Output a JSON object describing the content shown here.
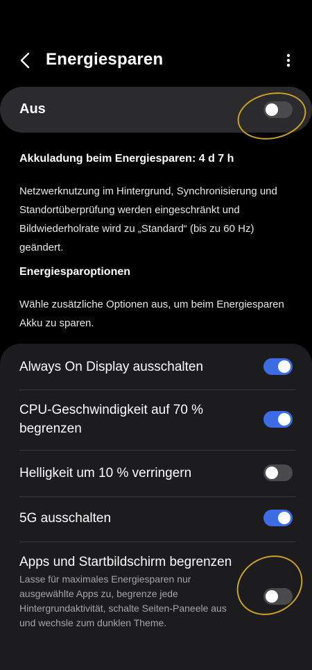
{
  "header": {
    "title": "Energiesparen"
  },
  "master": {
    "label": "Aus",
    "state": "off"
  },
  "info": {
    "heading": "Akkuladung beim Energiesparen: 4 d 7 h",
    "body": "Netzwerknutzung im Hintergrund, Synchronisierung und Standortüberprüfung werden eingeschränkt und Bildwiederholrate wird zu „Standard“ (bis zu 60 Hz) geändert."
  },
  "options": {
    "heading": "Energiesparoptionen",
    "body": "Wähle zusätzliche Optionen aus, um beim Energiesparen Akku zu sparen.",
    "items": [
      {
        "label": "Always On Display ausschalten",
        "state": "on"
      },
      {
        "label": "CPU-Geschwindigkeit auf 70 % begrenzen",
        "state": "on"
      },
      {
        "label": "Helligkeit um 10 % verringern",
        "state": "off"
      },
      {
        "label": "5G ausschalten",
        "state": "on"
      },
      {
        "label": "Apps und Startbildschirm begrenzen",
        "sublabel": "Lasse für maximales Energiesparen nur ausgewählte Apps zu, begrenze jede Hintergrundaktivität, schalte Seiten-Paneele aus und wechsle zum dunklen Theme.",
        "state": "off"
      }
    ]
  },
  "colors": {
    "accent": "#3e6ce5",
    "highlight": "#c9a227"
  },
  "icons": {
    "back": "back-arrow-icon",
    "more": "more-vert-icon"
  }
}
